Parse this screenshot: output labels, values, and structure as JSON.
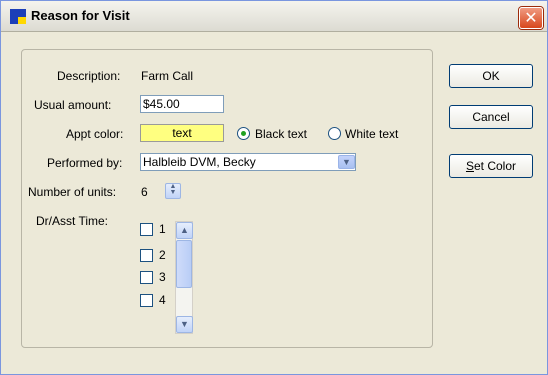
{
  "window": {
    "title": "Reason for Visit"
  },
  "form": {
    "description_label": "Description:",
    "description_value": "Farm Call",
    "usual_amount_label": "Usual amount:",
    "usual_amount_value": "$45.00",
    "appt_color_label": "Appt color:",
    "appt_color_swatch_text": "text",
    "appt_color_value": "#ffff80",
    "black_text_label": "Black text",
    "white_text_label": "White text",
    "text_color_selected": "Black text",
    "performed_by_label": "Performed by:",
    "performed_by_value": "Halbleib DVM, Becky",
    "units_label": "Number of units:",
    "units_value": "6",
    "time_label": "Dr/Asst Time:",
    "time_options": [
      "1",
      "2",
      "3",
      "4"
    ]
  },
  "buttons": {
    "ok": "OK",
    "cancel": "Cancel",
    "set_color_prefix": "S",
    "set_color_rest": "et Color"
  }
}
